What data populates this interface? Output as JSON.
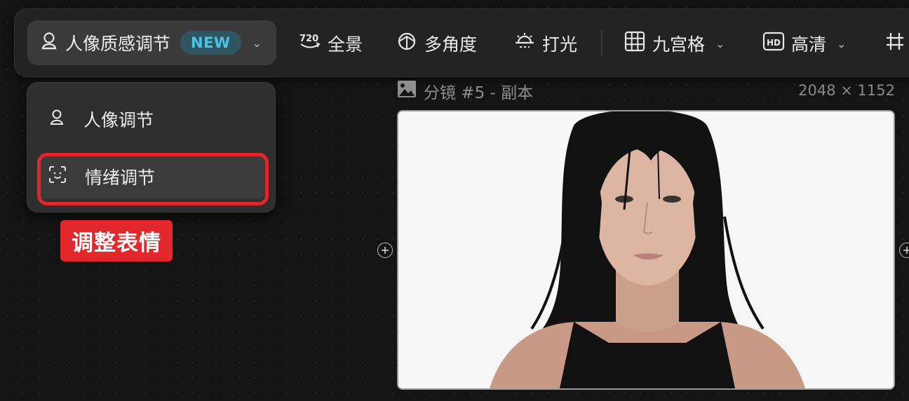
{
  "toolbar": {
    "portrait_label": "人像质感调节",
    "new_badge": "NEW",
    "panorama_label": "全景",
    "multi_angle_label": "多角度",
    "lighting_label": "打光",
    "grid_label": "九宫格",
    "hd_label": "高清",
    "icons": [
      "portrait-icon",
      "panorama-720-icon",
      "multi-angle-icon",
      "lighting-icon",
      "grid-icon",
      "hd-icon",
      "crop-icon"
    ]
  },
  "dropdown": {
    "items": [
      {
        "label": "人像调节",
        "icon": "portrait-icon",
        "active": false
      },
      {
        "label": "情绪调节",
        "icon": "face-scan-icon",
        "active": true
      }
    ]
  },
  "annotation": {
    "label": "调整表情",
    "color": "#e2282c"
  },
  "frame": {
    "title": "分镜 #5 - 副本",
    "size": "2048 × 1152"
  },
  "colors": {
    "accent": "#49c4e6",
    "highlight": "#e4262b",
    "background": "#141414",
    "toolbar": "#232323"
  }
}
